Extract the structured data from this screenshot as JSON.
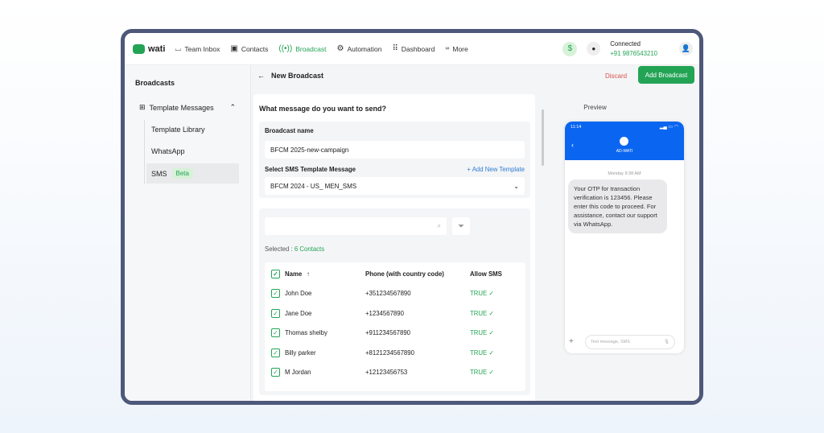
{
  "brand": {
    "name": "wati",
    "color": "#23a455"
  },
  "nav": [
    {
      "label": "Team Inbox",
      "icon": "inbox-icon"
    },
    {
      "label": "Contacts",
      "icon": "contacts-icon"
    },
    {
      "label": "Broadcast",
      "icon": "broadcast-icon",
      "active": true
    },
    {
      "label": "Automation",
      "icon": "automation-icon"
    },
    {
      "label": "Dashboard",
      "icon": "dashboard-icon"
    },
    {
      "label": "More",
      "icon": "more-icon"
    }
  ],
  "account": {
    "status": "Connected",
    "phone": "+91 9876543210",
    "currency_symbol": "$"
  },
  "sidebar": {
    "title": "Broadcasts",
    "group": "Template Messages",
    "items": [
      {
        "label": "Template Library"
      },
      {
        "label": "WhatsApp"
      },
      {
        "label": "SMS",
        "badge": "Beta"
      }
    ]
  },
  "header": {
    "title": "New Broadcast",
    "discard": "Discard",
    "add": "Add Broadcast"
  },
  "form": {
    "question": "What message do you want to send?",
    "name_label": "Broadcast name",
    "name_value": "BFCM 2025-new-campaign",
    "template_label": "Select SMS Template Message",
    "add_template": "+ Add New Template",
    "template_value": "BFCM 2024 - US_ MEN_SMS",
    "selected_prefix": "Selected : ",
    "selected_count": "6 Contacts",
    "search_placeholder": ""
  },
  "table": {
    "headers": [
      "Name",
      "Phone (with country code)",
      "Allow SMS"
    ],
    "sort": "↑",
    "rows": [
      [
        "John Doe",
        "+351234567890",
        "TRUE"
      ],
      [
        "Jane Doe",
        "+1234567890",
        "TRUE"
      ],
      [
        "Thomas shelby",
        "+911234567890",
        "TRUE"
      ],
      [
        "Billy parker",
        "+8121234567890",
        "TRUE"
      ],
      [
        "M Jordan",
        "+12123456753",
        "TRUE"
      ]
    ]
  },
  "preview": {
    "title": "Preview",
    "time": "11:14",
    "sender": "AD-WATI",
    "timestamp": "Monday 9:38 AM",
    "message": "Your OTP for transaction verification is 123456. Please enter this code to proceed. For assistance, contact our support via WhatsApp.",
    "input_placeholder": "Text message, SMS"
  }
}
